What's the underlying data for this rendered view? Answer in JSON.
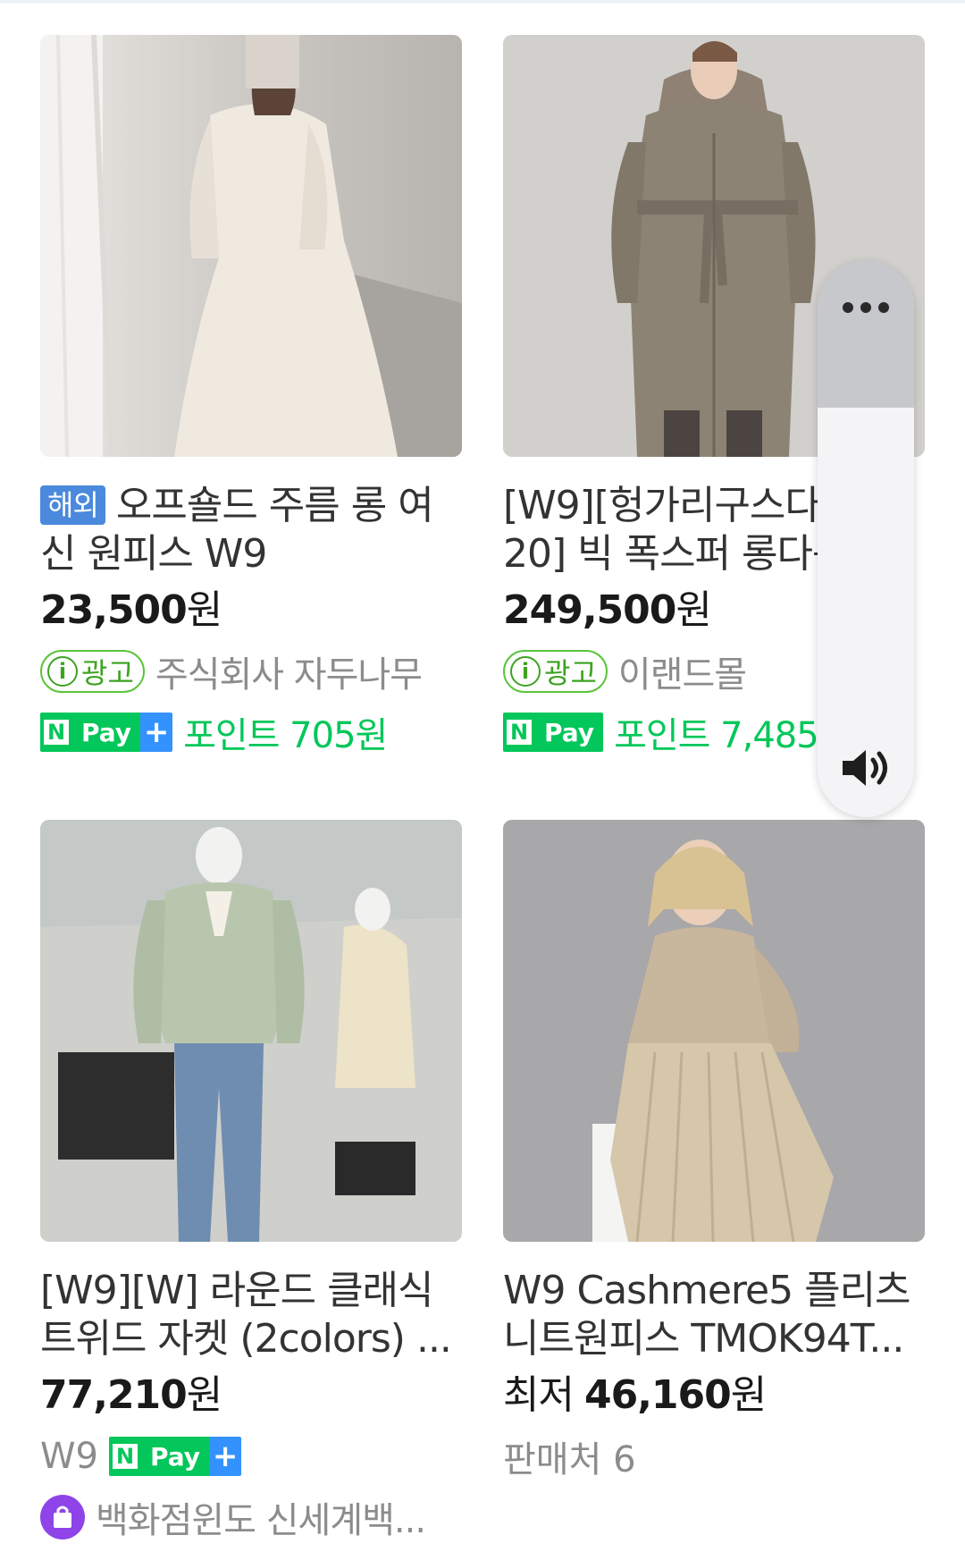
{
  "products": [
    {
      "overseas_badge": "해외",
      "title": "오프숄드 주름 롱 여신 원피스 W9",
      "price_number": "23,500",
      "price_unit": "원",
      "ad_label": "광고",
      "ad_info_icon": "i",
      "seller": "주식회사 자두나무",
      "npay_n": "N",
      "npay_pay": "Pay",
      "npay_plus": "+",
      "points": "포인트 705원"
    },
    {
      "title": "[W9][헝가리구스다운 20] 빅 폭스퍼 롱다운",
      "price_number": "249,500",
      "price_unit": "원",
      "ad_label": "광고",
      "ad_info_icon": "i",
      "seller": "이랜드몰",
      "npay_n": "N",
      "npay_pay": "Pay",
      "points": "포인트 7,485원"
    },
    {
      "title": "[W9][W] 라운드 클래식 트위드 자켓 (2colors) ...",
      "price_number": "77,210",
      "price_unit": "원",
      "brand": "W9",
      "npay_n": "N",
      "npay_pay": "Pay",
      "npay_plus": "+",
      "store": "백화점윈도 신세계백...",
      "store_icon": "shopping-bag-icon"
    },
    {
      "title": "W9 Cashmere5 플리츠 니트원피스 TMOK94T...",
      "price_prefix": "최저",
      "price_number": "46,160",
      "price_unit": "원",
      "sellers": "판매처 6"
    }
  ],
  "colors": {
    "npay_green": "#03c75a",
    "npay_plus_blue": "#3492ff",
    "ad_green": "#3da321",
    "overseas_blue": "#4a89dc",
    "store_purple": "#8e44e8"
  },
  "volume_panel": {
    "menu_icon": "more-horizontal-icon",
    "speaker_icon": "speaker-volume-icon",
    "level": 0.7
  }
}
